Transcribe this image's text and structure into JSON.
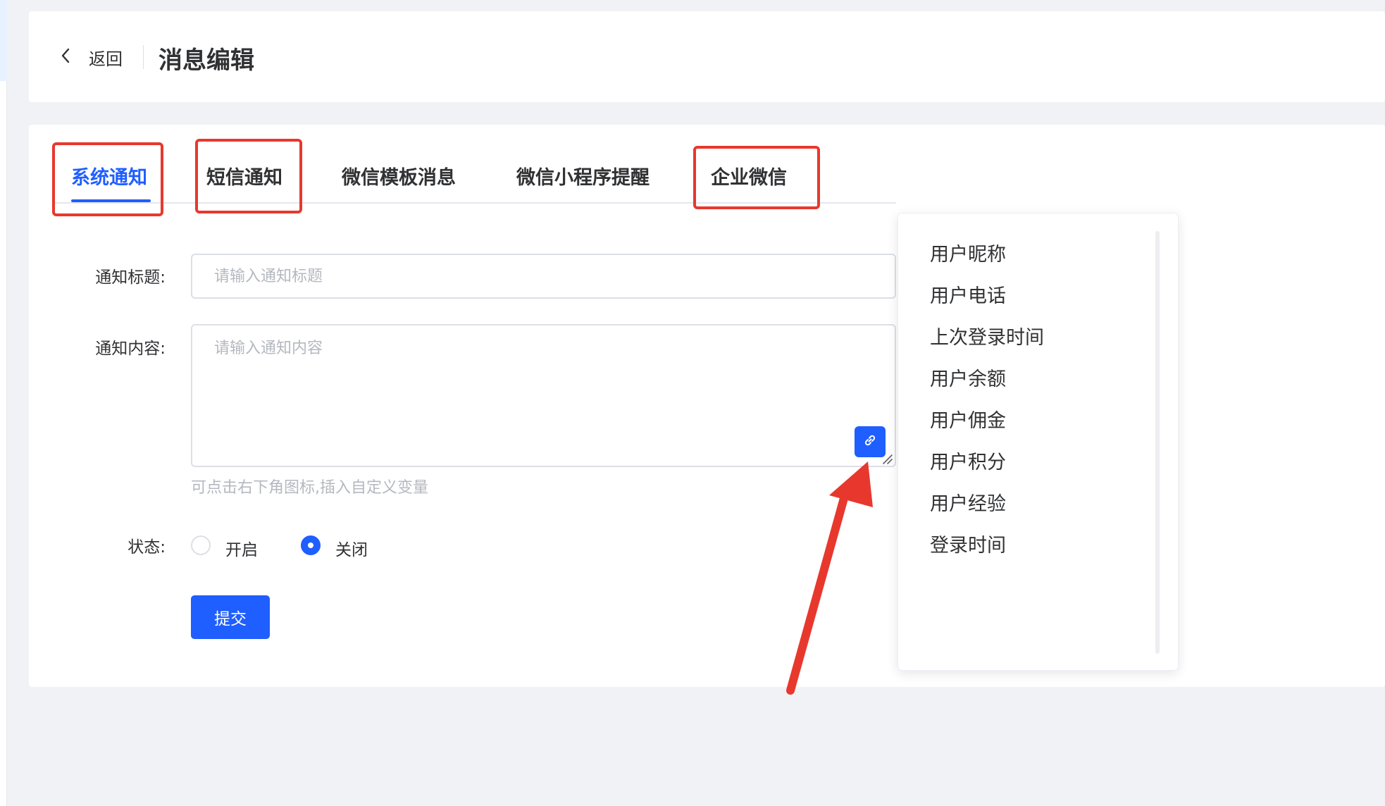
{
  "header": {
    "back_label": "返回",
    "title": "消息编辑"
  },
  "tabs": [
    {
      "label": "系统通知",
      "active": true
    },
    {
      "label": "短信通知",
      "active": false
    },
    {
      "label": "微信模板消息",
      "active": false
    },
    {
      "label": "微信小程序提醒",
      "active": false
    },
    {
      "label": "企业微信",
      "active": false
    }
  ],
  "form": {
    "title_label": "通知标题:",
    "title_placeholder": "请输入通知标题",
    "title_value": "",
    "content_label": "通知内容:",
    "content_placeholder": "请输入通知内容",
    "content_value": "",
    "hint": "可点击右下角图标,插入自定义变量",
    "status_label": "状态:",
    "status_options": [
      {
        "label": "开启",
        "checked": false
      },
      {
        "label": "关闭",
        "checked": true
      }
    ],
    "submit_label": "提交"
  },
  "variables": [
    "用户昵称",
    "用户电话",
    "上次登录时间",
    "用户余额",
    "用户佣金",
    "用户积分",
    "用户经验",
    "登录时间"
  ],
  "icons": {
    "back": "chevron-left-icon",
    "insert_variable": "link-icon",
    "resize": "resize-handle-icon"
  },
  "colors": {
    "primary": "#1f5eff",
    "annotation": "#e8382d",
    "background": "#f0f2f5",
    "placeholder": "#b4b8bf"
  }
}
